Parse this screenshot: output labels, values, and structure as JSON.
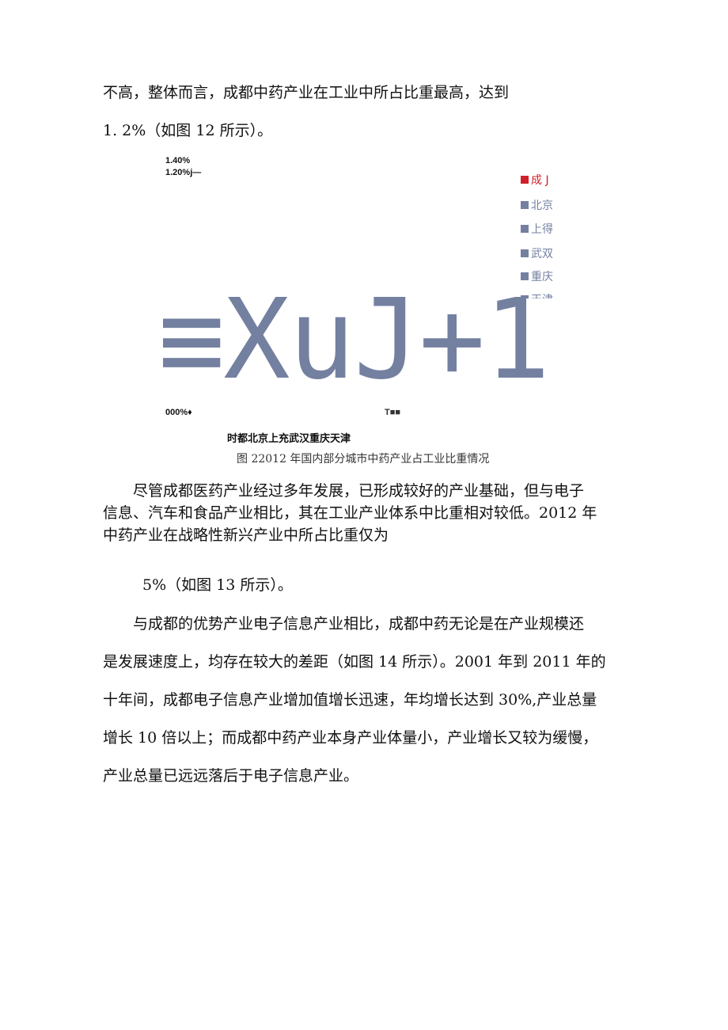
{
  "paragraphs": {
    "p1_l1": "不高，整体而言，成都中药产业在工业中所占比重最高，达到",
    "p1_l2": "1. 2%（如图 12 所示）。",
    "p2_l1": "尽管成都医药产业经过多年发展，已形成较好的产业基础，但与电子",
    "p2_l2": "信息、汽车和食品产业相比，其在工业产业体系中比重相对较低。2012 年",
    "p2_l3": "中药产业在战略性新兴产业中所占比重仅为",
    "p2_l4": "5%（如图 13 所示）。",
    "p3_l1": "与成都的优势产业电子信息产业相比，成都中药无论是在产业规模还",
    "p3_l2": "是发展速度上，均存在较大的差距（如图 14 所示）。2001 年到 2011 年的",
    "p3_l3": "十年间，成都电子信息产业增加值增长迅速，年均增长达到 30%,产业总量",
    "p3_l4": "增长 10 倍以上；而成都中药产业本身产业体量小，产业增长又较为缓慢，",
    "p3_l5": "产业总量已远远落后于电子信息产业。"
  },
  "figure": {
    "y_tick_top": "1.40%",
    "y_tick_2": "1.20%j—",
    "y_tick_bottom": "000%♦",
    "x_marker": "T■■",
    "garbled_text": "≡XuJ+1",
    "x_labels": "时都北京上充武汉重庆天津",
    "caption": "图 22012 年国内部分城市中药产业占工业比重情况",
    "legend": [
      "成 J",
      "北京",
      "上得",
      "武双",
      "重庆",
      "天津"
    ],
    "colors": {
      "highlight": "#d0202a",
      "series": "#7480a0"
    }
  }
}
